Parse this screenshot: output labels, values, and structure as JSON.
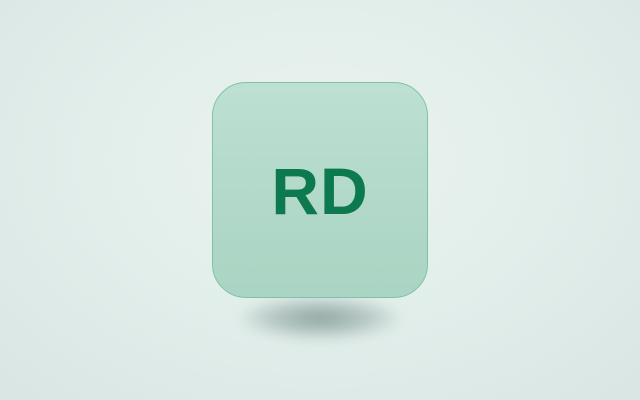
{
  "avatar": {
    "initials": "RD",
    "text_color": "#0c7a4e",
    "tile_color": "#b3d9ca",
    "border_color": "#7cc4a6"
  },
  "background": {
    "color": "#e3efeb"
  }
}
